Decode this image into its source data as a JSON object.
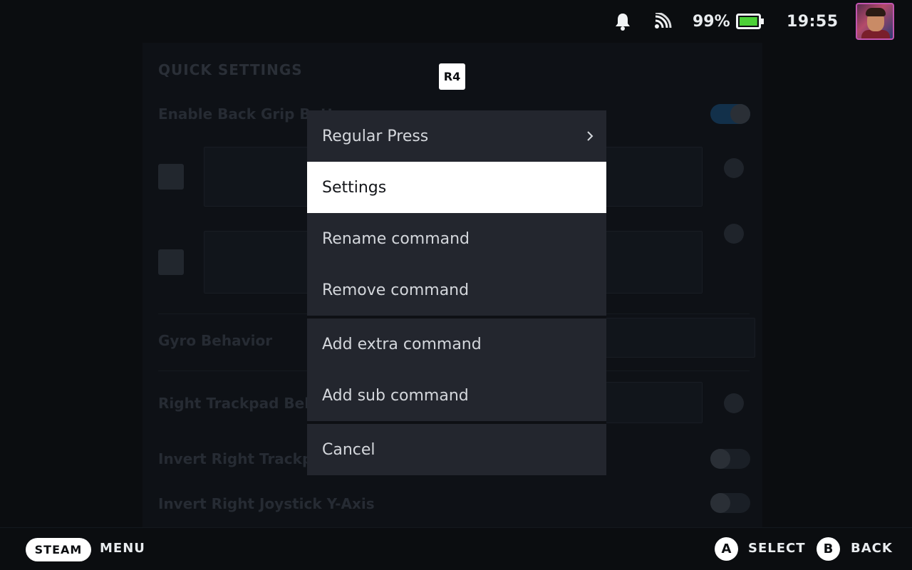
{
  "status_bar": {
    "battery_percent": "99%",
    "battery_level": 0.99,
    "time": "19:55",
    "icons": [
      "bell-icon",
      "wifi-icon",
      "battery-icon"
    ]
  },
  "background": {
    "title": "QUICK SETTINGS",
    "rows": [
      "Enable Back Grip Buttons",
      "Gyro Behavior",
      "Right Trackpad Behavior",
      "Invert Right Trackpad",
      "Invert Right Joystick Y-Axis"
    ]
  },
  "button_badge": "R4",
  "menu": {
    "groups": [
      {
        "items": [
          {
            "label": "Regular Press",
            "has_submenu": true
          },
          {
            "label": "Settings",
            "focused": true
          },
          {
            "label": "Rename command"
          },
          {
            "label": "Remove command"
          }
        ]
      },
      {
        "items": [
          {
            "label": "Add extra command"
          },
          {
            "label": "Add sub command"
          }
        ]
      },
      {
        "items": [
          {
            "label": "Cancel"
          }
        ]
      }
    ]
  },
  "footer": {
    "steam_label": "STEAM",
    "menu_label": "MENU",
    "a_glyph": "A",
    "select_label": "SELECT",
    "b_glyph": "B",
    "back_label": "BACK"
  },
  "colors": {
    "menu_bg": "#23262e",
    "focused_bg": "#ffffff",
    "battery_green": "#4cd137"
  }
}
